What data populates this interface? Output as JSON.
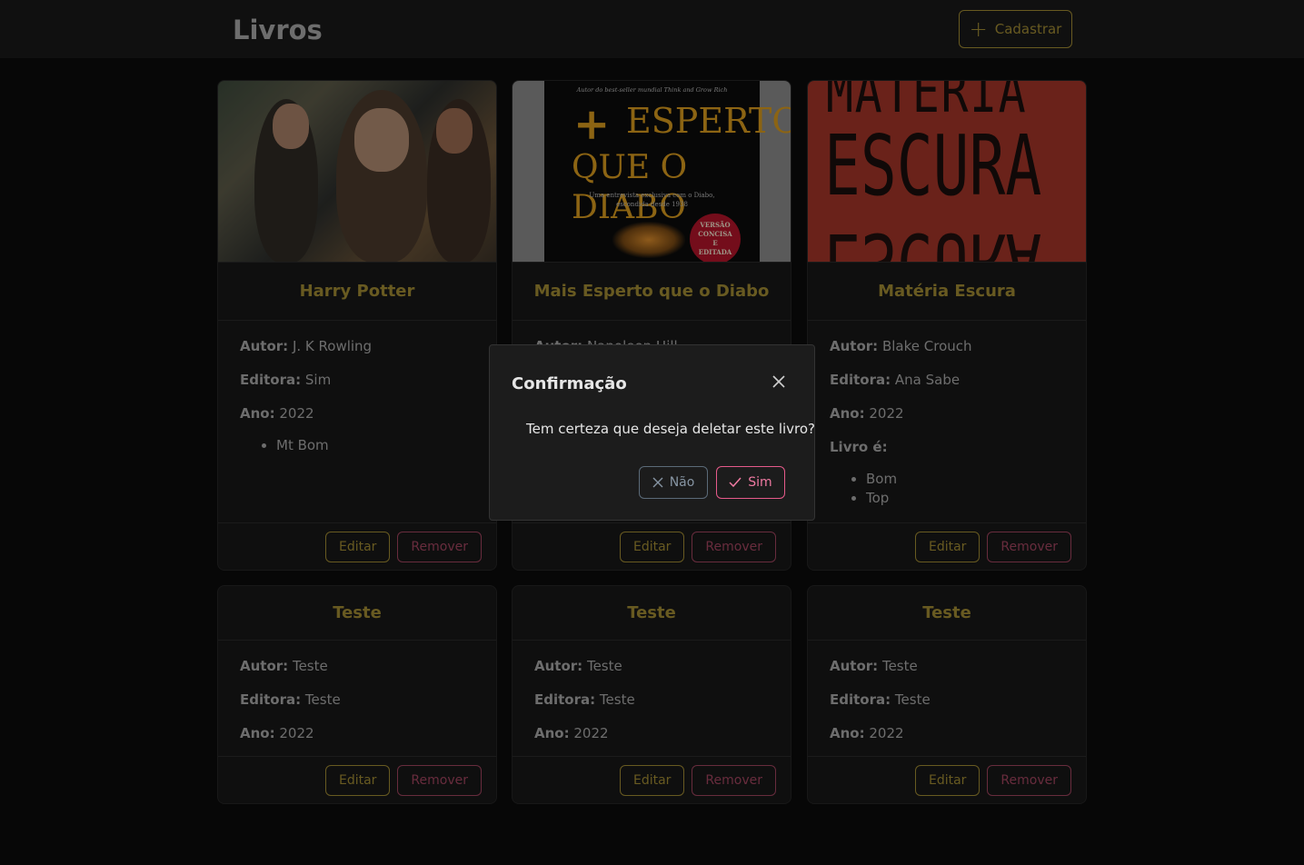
{
  "header": {
    "title": "Livros",
    "register_button": "Cadastrar",
    "register_icon": "plus-icon"
  },
  "books": [
    {
      "title": "Harry Potter",
      "author_label": "Autor:",
      "author": "J. K Rowling",
      "publisher_label": "Editora:",
      "publisher": "Sim",
      "year_label": "Ano:",
      "year": "2022",
      "tags_label": "",
      "tags": [
        "Mt Bom"
      ],
      "edit_label": "Editar",
      "remove_label": "Remover"
    },
    {
      "title": "Mais Esperto que o Diabo",
      "author_label": "Autor:",
      "author": "Napoleon Hill",
      "cover_kicker": "Autor do best-seller mundial Think and Grow Rich",
      "cover_line1": "ESPERTO",
      "cover_line2": "QUE O DIABO",
      "cover_sub1": "Uma entrevista exclusiva com o Diabo,",
      "cover_sub2": "escondida desde 1938",
      "cover_seal": "VERSÃO CONCISA E EDITADA",
      "edit_label": "Editar",
      "remove_label": "Remover"
    },
    {
      "title": "Matéria Escura",
      "author_label": "Autor:",
      "author": "Blake Crouch",
      "publisher_label": "Editora:",
      "publisher": "Ana Sabe",
      "year_label": "Ano:",
      "year": "2022",
      "tags_label": "Livro é:",
      "tags": [
        "Bom",
        "Top"
      ],
      "cover_line1": "MATERIA",
      "cover_line2": "ESCURA",
      "edit_label": "Editar",
      "remove_label": "Remover"
    },
    {
      "title": "Teste",
      "author_label": "Autor:",
      "author": "Teste",
      "publisher_label": "Editora:",
      "publisher": "Teste",
      "year_label": "Ano:",
      "year": "2022",
      "edit_label": "Editar",
      "remove_label": "Remover"
    },
    {
      "title": "Teste",
      "author_label": "Autor:",
      "author": "Teste",
      "publisher_label": "Editora:",
      "publisher": "Teste",
      "year_label": "Ano:",
      "year": "2022",
      "edit_label": "Editar",
      "remove_label": "Remover"
    },
    {
      "title": "Teste",
      "author_label": "Autor:",
      "author": "Teste",
      "publisher_label": "Editora:",
      "publisher": "Teste",
      "year_label": "Ano:",
      "year": "2022",
      "edit_label": "Editar",
      "remove_label": "Remover"
    }
  ],
  "dialog": {
    "title": "Confirmação",
    "message": "Tem certeza que deseja deletar este livro?",
    "no_label": "Não",
    "yes_label": "Sim",
    "close_icon": "close-icon",
    "no_icon": "x-icon",
    "yes_icon": "check-icon"
  },
  "colors": {
    "accent": "#a08a33",
    "danger": "#a0445f",
    "confirm": "#e65a8a",
    "background": "#0b0b0b",
    "card": "#181818"
  }
}
